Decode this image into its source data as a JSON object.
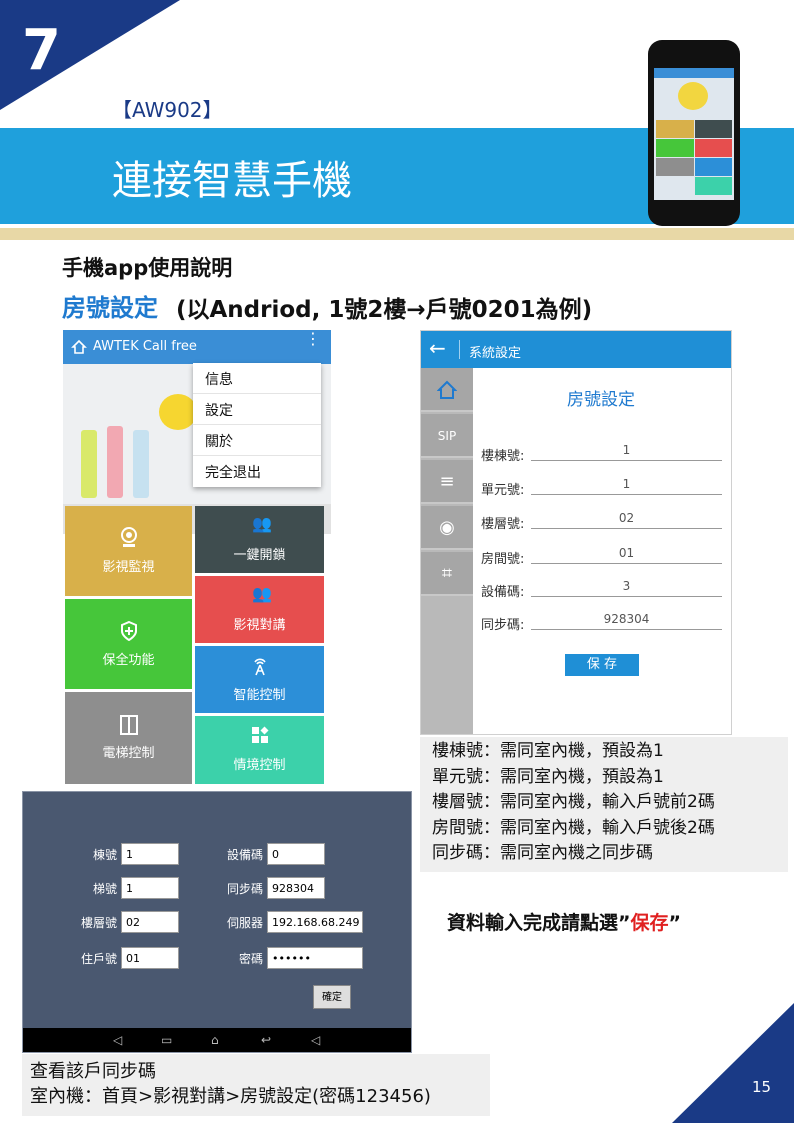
{
  "header": {
    "chapter": "7",
    "model": "【AW902】",
    "title": "連接智慧手機"
  },
  "guide_heading": "手機app使用說明",
  "section": {
    "title": "房號設定",
    "note": "(以Andriod, 1號2樓→戶號0201為例)"
  },
  "app": {
    "app_name": "AWTEK Call free",
    "menu_items": [
      "信息",
      "設定",
      "關於",
      "完全退出"
    ],
    "tiles": [
      {
        "label": "影視監視",
        "color": "#d8b04a",
        "icon": "camera-icon"
      },
      {
        "label": "一鍵開鎖",
        "color": "#3f4d4f",
        "icon": "unlock-icon"
      },
      {
        "label": "影視對講",
        "color": "#e64e4e",
        "icon": "intercom-icon"
      },
      {
        "label": "保全功能",
        "color": "#46c63a",
        "icon": "shield-icon"
      },
      {
        "label": "智能控制",
        "color": "#2c8fd8",
        "icon": "antenna-icon"
      },
      {
        "label": "電梯控制",
        "color": "#8e8e8e",
        "icon": "elevator-icon"
      },
      {
        "label": "情境控制",
        "color": "#3cd1aa",
        "icon": "scene-icon"
      }
    ]
  },
  "settings": {
    "bar_title": "系統設定",
    "heading": "房號設定",
    "side_sip": "SIP",
    "fields": [
      {
        "label": "樓棟號:",
        "value": "1"
      },
      {
        "label": "單元號:",
        "value": "1"
      },
      {
        "label": "樓層號:",
        "value": "02"
      },
      {
        "label": "房間號:",
        "value": "01"
      },
      {
        "label": "設備碼:",
        "value": "3"
      },
      {
        "label": "同步碼:",
        "value": "928304"
      }
    ],
    "save_label": "保 存"
  },
  "explanation": [
    "樓棟號：需同室內機，預設為1",
    "單元號：需同室內機，預設為1",
    "樓層號：需同室內機，輸入戶號前2碼",
    "房間號：需同室內機，輸入戶號後2碼",
    "同步碼：需同室內機之同步碼"
  ],
  "save_hint": {
    "prefix": "資料輸入完成請點選",
    "quote_open": "”",
    "action": "保存",
    "quote_close": "”"
  },
  "panel": {
    "fields_left": [
      {
        "label": "棟號",
        "value": "1"
      },
      {
        "label": "梯號",
        "value": "1"
      },
      {
        "label": "樓層號",
        "value": "02"
      },
      {
        "label": "住戶號",
        "value": "01"
      }
    ],
    "fields_right": [
      {
        "label": "設備碼",
        "value": "0"
      },
      {
        "label": "同步碼",
        "value": "928304"
      },
      {
        "label": "伺服器",
        "value": "192.168.68.249"
      },
      {
        "label": "密碼",
        "value": "••••••"
      }
    ],
    "confirm_label": "確定"
  },
  "check_note": {
    "line1": "查看該戶同步碼",
    "line2": "室內機：首頁>影視對講>房號設定(密碼123456)"
  },
  "page_number": "15",
  "colors": {
    "navy": "#1a3a86",
    "band_blue": "#1fa0dc",
    "heading_blue": "#1f7acf",
    "save_red": "#e02020"
  }
}
